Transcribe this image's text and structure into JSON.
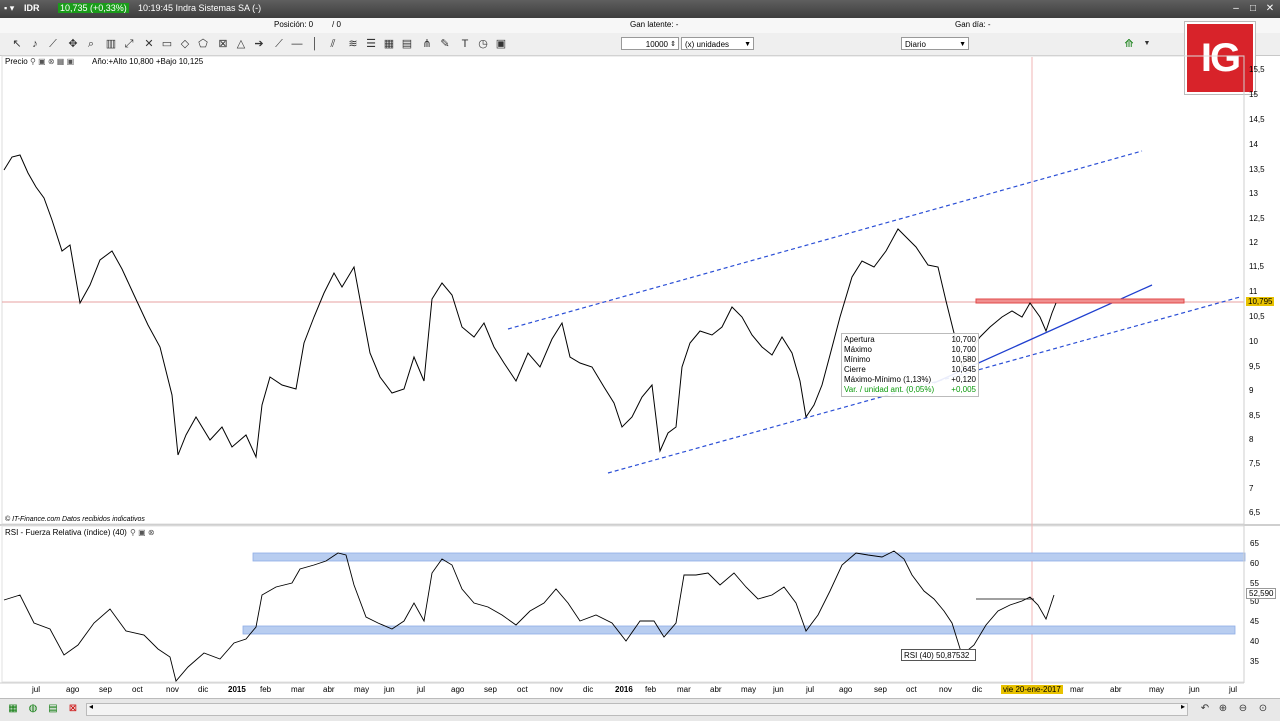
{
  "titlebar": {
    "symbol": "IDR",
    "price_change": "10,735 (+0,33%)",
    "time_name": "10:19:45 Indra Sistemas SA (-)"
  },
  "subbar": {
    "position_label": "Posición: 0",
    "position_slash": "/ 0",
    "gan_latente": "Gan latente: -",
    "gan_dia": "Gan día: -"
  },
  "toolbar": {
    "quantity": "10000",
    "units": "(x) unidades",
    "period": "Diario"
  },
  "logo": "IG",
  "price_panel": {
    "title": "Precio",
    "year_range": "Año:+Alto 10,800 +Bajo 10,125",
    "source": "© IT-Finance.com  Datos recibidos indicativos",
    "current_price": "10,795",
    "y_ticks": [
      "15,5",
      "15",
      "14,5",
      "14",
      "13,5",
      "13",
      "12,5",
      "12",
      "11,5",
      "11",
      "10,5",
      "10",
      "9,5",
      "9",
      "8,5",
      "8",
      "7,5",
      "7",
      "6,5"
    ]
  },
  "infobox": {
    "rows": [
      {
        "label": "Apertura",
        "value": "10,700"
      },
      {
        "label": "Máximo",
        "value": "10,700"
      },
      {
        "label": "Mínimo",
        "value": "10,580"
      },
      {
        "label": "Cierre",
        "value": "10,645"
      },
      {
        "label": "Máximo-Mínimo (1,13%)",
        "value": "+0,120"
      },
      {
        "label": "Var. / unidad ant. (0,05%)",
        "value": "+0,005"
      }
    ]
  },
  "rsi_panel": {
    "title": "RSI - Fuerza Relativa (índice) (40)",
    "label": "RSI (40)  50,87532",
    "current_value": "52,590",
    "y_ticks": [
      "65",
      "60",
      "55",
      "50",
      "45",
      "40",
      "35"
    ]
  },
  "x_axis": {
    "labels": [
      "jul",
      "ago",
      "sep",
      "oct",
      "nov",
      "dic",
      "2015",
      "feb",
      "mar",
      "abr",
      "may",
      "jun",
      "jul",
      "ago",
      "sep",
      "oct",
      "nov",
      "dic",
      "2016",
      "feb",
      "mar",
      "abr",
      "may",
      "jun",
      "jul",
      "ago",
      "sep",
      "oct",
      "nov",
      "dic",
      "vie 20-ene-2017",
      "mar",
      "abr",
      "may",
      "jun",
      "jul"
    ]
  },
  "colors": {
    "price_line": "#000000",
    "trend_dashed": "#2b4fd6",
    "trend_solid": "#1f3fcf",
    "resistance": "#e04848",
    "crosshair": "#f2b6b6",
    "rsi_band": "#b8cdf0",
    "price_badge": "#e8c200",
    "ig_red": "#d8232a"
  }
}
